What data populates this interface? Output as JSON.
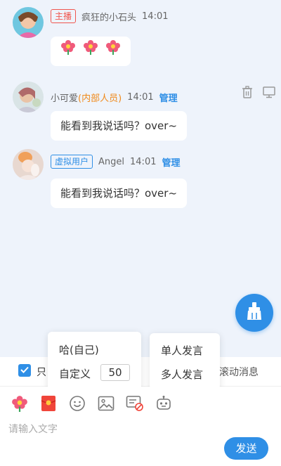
{
  "messages": [
    {
      "badge": "主播",
      "name": "疯狂的小石头",
      "time": "14:01",
      "content_icons": [
        "flower-icon",
        "flower-icon",
        "flower-icon"
      ]
    },
    {
      "name": "小可爱",
      "internal": "(内部人员)",
      "time": "14:01",
      "manage": "管理",
      "text": "能看到我说话吗？over~",
      "actions": [
        "trash-icon",
        "monitor-icon"
      ]
    },
    {
      "badge": "虚拟用户",
      "name": "Angel",
      "time": "14:01",
      "manage": "管理",
      "text": "能看到我说话吗？over~"
    }
  ],
  "filter": {
    "checkbox_label": "只",
    "checked": true,
    "scroll_label": "滚动消息"
  },
  "popup_left": {
    "item1": "哈(自己)",
    "item2_label": "自定义",
    "item2_value": "50"
  },
  "popup_right": {
    "item1": "单人发言",
    "item2": "多人发言"
  },
  "toolbar": [
    "flower-icon",
    "red-packet-icon",
    "emoji-icon",
    "image-icon",
    "no-comment-icon",
    "robot-icon"
  ],
  "input": {
    "placeholder": "请输入文字",
    "send_label": "发送"
  },
  "colors": {
    "accent": "#2f8fe6",
    "host_badge": "#f0564e",
    "internal": "#f08a1c",
    "background": "#eef3fb"
  }
}
